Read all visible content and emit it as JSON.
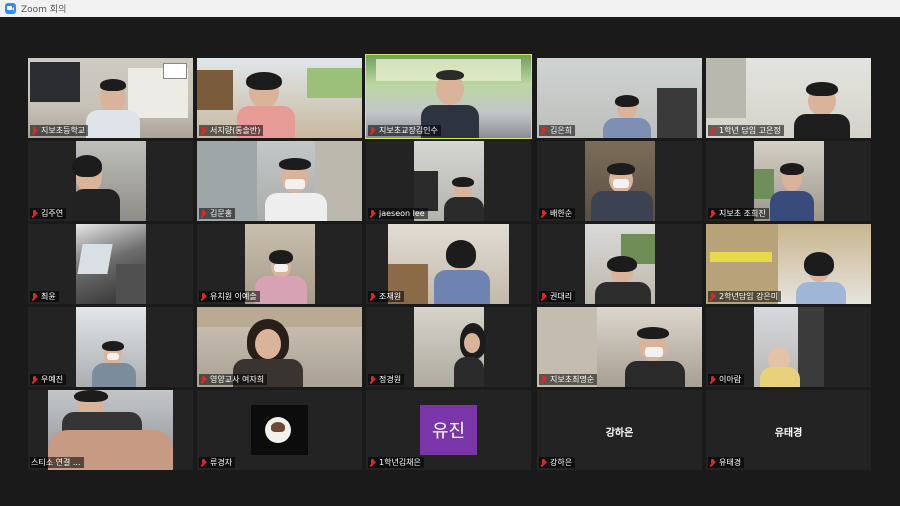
{
  "window": {
    "title": "Zoom 회의"
  },
  "participants": [
    {
      "name": "지보초등학교",
      "muted": true
    },
    {
      "name": "서지량(통솔반)",
      "muted": true
    },
    {
      "name": "지보초교장김인수",
      "muted": true,
      "active": true
    },
    {
      "name": "김은희",
      "muted": true
    },
    {
      "name": "1학년 담임 고은정",
      "muted": true
    },
    {
      "name": "김주연",
      "muted": true
    },
    {
      "name": "김문홍",
      "muted": true
    },
    {
      "name": "jaeseon lee",
      "muted": true
    },
    {
      "name": "배한순",
      "muted": true
    },
    {
      "name": "지보초 조희진",
      "muted": true
    },
    {
      "name": "최윤",
      "muted": true
    },
    {
      "name": "유치원 이예솔",
      "muted": true
    },
    {
      "name": "조재원",
      "muted": true
    },
    {
      "name": "권대리",
      "muted": true
    },
    {
      "name": "2학년담임 강은미",
      "muted": true
    },
    {
      "name": "우예진",
      "muted": true
    },
    {
      "name": "영양교사 여자희",
      "muted": true
    },
    {
      "name": "정경원",
      "muted": true
    },
    {
      "name": "지보초최명순",
      "muted": true
    },
    {
      "name": "이아람",
      "muted": true
    },
    {
      "name": "스티소 연결 ...",
      "muted": false
    },
    {
      "name": "류경자",
      "muted": true
    },
    {
      "name": "1학년김채은",
      "muted": true,
      "avatar_text": "유진"
    },
    {
      "name": "강하은",
      "muted": true,
      "center_text": "강하은"
    },
    {
      "name": "유태경",
      "muted": true,
      "center_text": "유태경"
    }
  ],
  "colors": {
    "active_border": "#d9e84a",
    "avatar_bg": "#7a35a8",
    "muted_icon": "#e02828"
  }
}
